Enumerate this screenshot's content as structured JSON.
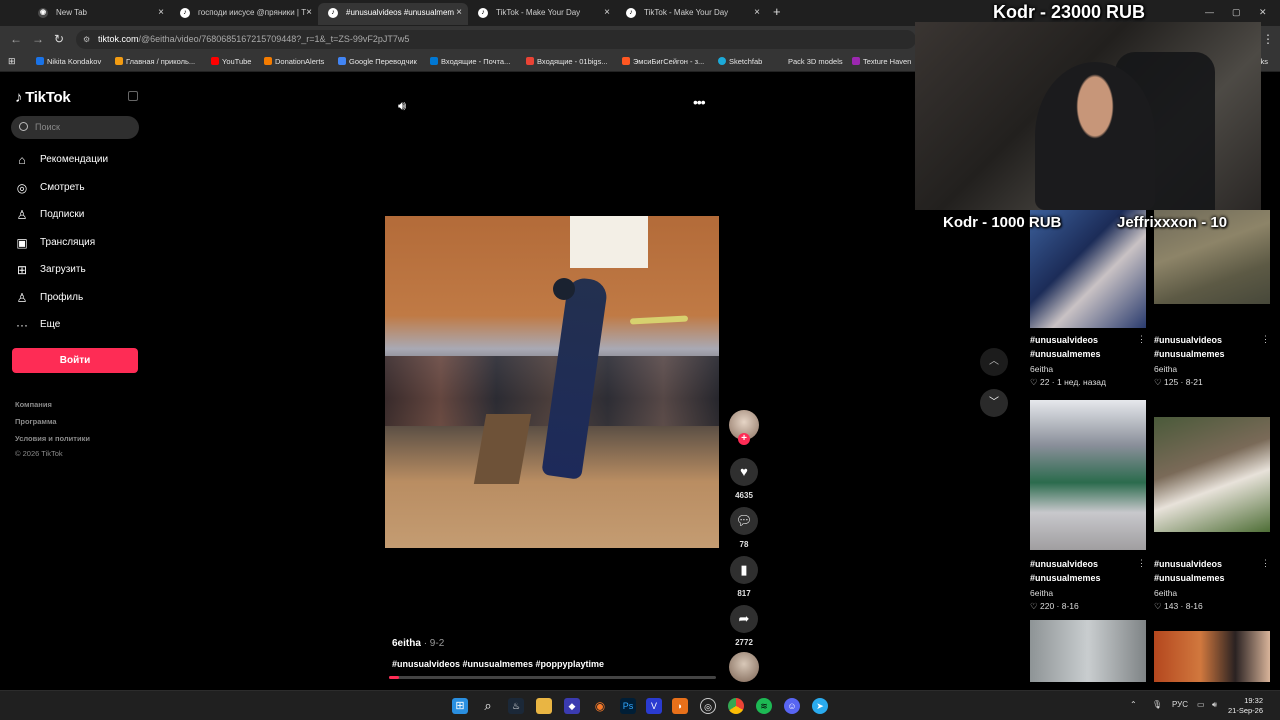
{
  "browser": {
    "tabs": [
      {
        "title": "New Tab",
        "active": false
      },
      {
        "title": "господи иисусе @пряники | T",
        "active": false
      },
      {
        "title": "#unusualvideos #unusualmem",
        "active": true
      },
      {
        "title": "TikTok - Make Your Day",
        "active": false
      },
      {
        "title": "TikTok - Make Your Day",
        "active": false
      }
    ],
    "new_tab_symbol": "+",
    "url_domain": "tiktok.com",
    "url_rest": "/@6eitha/video/7680685167215709448?_r=1&_t=ZS-99vF2pJT7w5",
    "bookmarks": [
      {
        "label": "Nikita Kondakov",
        "color": "#1a73e8"
      },
      {
        "label": "Главная / приколь...",
        "color": "#f39c12"
      },
      {
        "label": "YouTube",
        "color": "#ff0000"
      },
      {
        "label": "DonationAlerts",
        "color": "#f57c00"
      },
      {
        "label": "Google Переводчик",
        "color": "#4285f4"
      },
      {
        "label": "Входящие - Почта...",
        "color": "#0078d4"
      },
      {
        "label": "Входящие - 01bigs...",
        "color": "#ea4335"
      },
      {
        "label": "ЭмсиБигСейгон - з...",
        "color": "#ff5722"
      },
      {
        "label": "Sketchfab",
        "color": "#1caad9"
      },
      {
        "label": "Pack 3D models",
        "color": "#555555"
      },
      {
        "label": "Texture Haven",
        "color": "#9c27b0"
      }
    ],
    "bookmarks_overflow": "rks"
  },
  "sidebar": {
    "logo": "TikTok",
    "search_placeholder": "Поиск",
    "items": [
      {
        "label": "Рекомендации",
        "icon": "home-icon",
        "glyph": "⌂"
      },
      {
        "label": "Смотреть",
        "icon": "compass-icon",
        "glyph": "◎"
      },
      {
        "label": "Подписки",
        "icon": "following-icon",
        "glyph": "♙"
      },
      {
        "label": "Трансляция",
        "icon": "live-icon",
        "glyph": "▣"
      },
      {
        "label": "Загрузить",
        "icon": "upload-icon",
        "glyph": "⊞"
      },
      {
        "label": "Профиль",
        "icon": "profile-icon",
        "glyph": "♙"
      },
      {
        "label": "Еще",
        "icon": "more-icon",
        "glyph": "···"
      }
    ],
    "login_label": "Войти",
    "footer": [
      "Компания",
      "Программа",
      "Условия и политики",
      "© 2026 TikTok"
    ]
  },
  "video": {
    "author": "6eitha",
    "date": "· 9-2",
    "description": "#unusualvideos #unusualmemes #poppyplaytime",
    "progress": 0.03,
    "likes": "4635",
    "comments": "78",
    "bookmarks": "817",
    "shares": "2772"
  },
  "overlay": {
    "donation_top": "Kodr - 23000 RUB",
    "donation_left": "Kodr - 1000 RUB",
    "donation_right": "Jeffrixxxon - 10"
  },
  "grid": [
    {
      "title": "#unusualvideos #unusualmemes",
      "user": "6eitha",
      "meta": "22 · 1 нед. назад"
    },
    {
      "title": "#unusualvideos #unusualmemes",
      "user": "6eitha",
      "meta": "125 · 8-21"
    },
    {
      "title": "#unusualvideos #unusualmemes",
      "user": "6eitha",
      "meta": "220 · 8-16"
    },
    {
      "title": "#unusualvideos #unusualmemes",
      "user": "6eitha",
      "meta": "143 · 8-16"
    }
  ],
  "taskbar": {
    "lang": "РУС",
    "time": "19:32",
    "date": "21-Sep-26"
  }
}
